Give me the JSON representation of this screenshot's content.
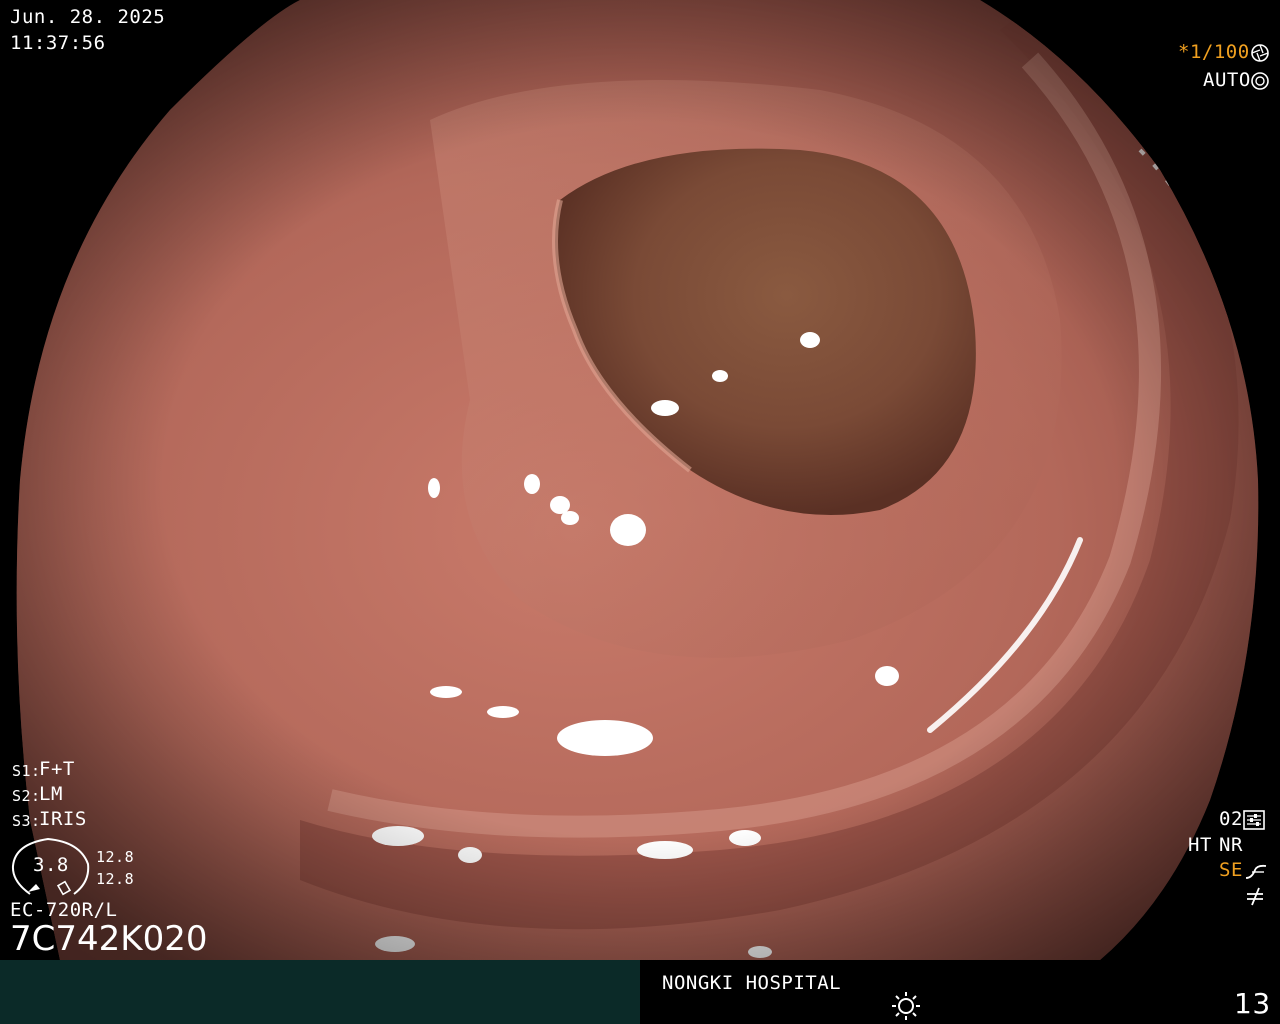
{
  "header": {
    "date": "Jun. 28. 2025",
    "time": "11:37:56"
  },
  "exposure": {
    "shutter": "*1/100",
    "mode": "AUTO",
    "shutter_icon": "aperture-icon",
    "auto_icon": "iris-icon"
  },
  "presets": {
    "s1": "S1:",
    "s1_value": "F+T",
    "s2": "S2:",
    "s2_value": "LM",
    "s3": "S3:",
    "s3_value": "IRIS"
  },
  "gauge": {
    "value": "3.8",
    "top_value": "12.8",
    "bottom_value": "12.8"
  },
  "device": {
    "model": "EC-720R/L",
    "serial": "7C742K020"
  },
  "settings": {
    "level": "02",
    "level_icon": "sliders-icon",
    "ht": "HT",
    "nr": "NR",
    "se": "SE",
    "se_icon": "curve-icon",
    "extra_icon": "not-equal-icon"
  },
  "footer": {
    "hospital": "NONGKI HOSPITAL",
    "brightness_icon": "sun-icon",
    "number": "13"
  },
  "colors": {
    "overlay_text": "#ffffff",
    "accent": "#f0a020",
    "footer_left_bg": "#0b2a28",
    "mucosa": "#b3685a"
  }
}
